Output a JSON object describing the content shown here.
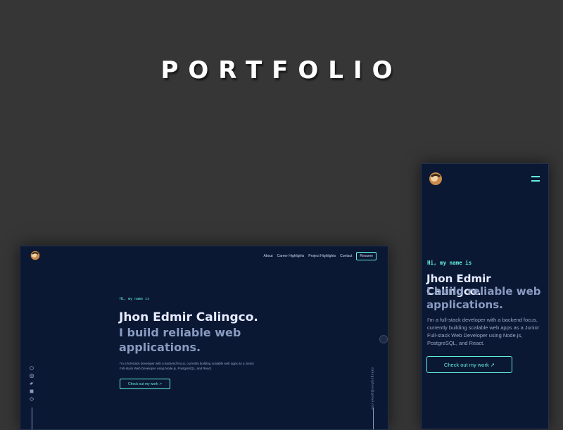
{
  "headline": "PORTFOLIO",
  "colors": {
    "accent": "#64f0d8",
    "navy": "#0b1834",
    "slate": "#8a9bc2",
    "bg": "#363636"
  },
  "desktop": {
    "nav": [
      "About",
      "Career Highlights",
      "Project Highlights",
      "Contact"
    ],
    "resume": "Resume",
    "greeting": "Hi, my name is",
    "name": "Jhon Edmir Calingco.",
    "tagline": "I build reliable web applications.",
    "description": "I'm a full-stack developer with a backend focus, currently building scalable web apps as a Junior Full-stack Web Developer using Node.js, PostgreSQL, and React.",
    "cta": "Check out my work ↗",
    "email": "calingcojhon@gmail.com",
    "social_icons": [
      "github-icon",
      "instagram-icon",
      "twitter-icon",
      "linkedin-icon",
      "codepen-icon"
    ]
  },
  "mobile": {
    "greeting": "Hi, my name is",
    "name": "Jhon Edmir Calingco.",
    "tagline": "I build reliable web applications.",
    "description": "I'm a full-stack developer with a backend focus, currently building scalable web apps as a Junior Full-stack Web Developer using Node.js, PostgreSQL, and React.",
    "cta": "Check out my work ↗"
  }
}
